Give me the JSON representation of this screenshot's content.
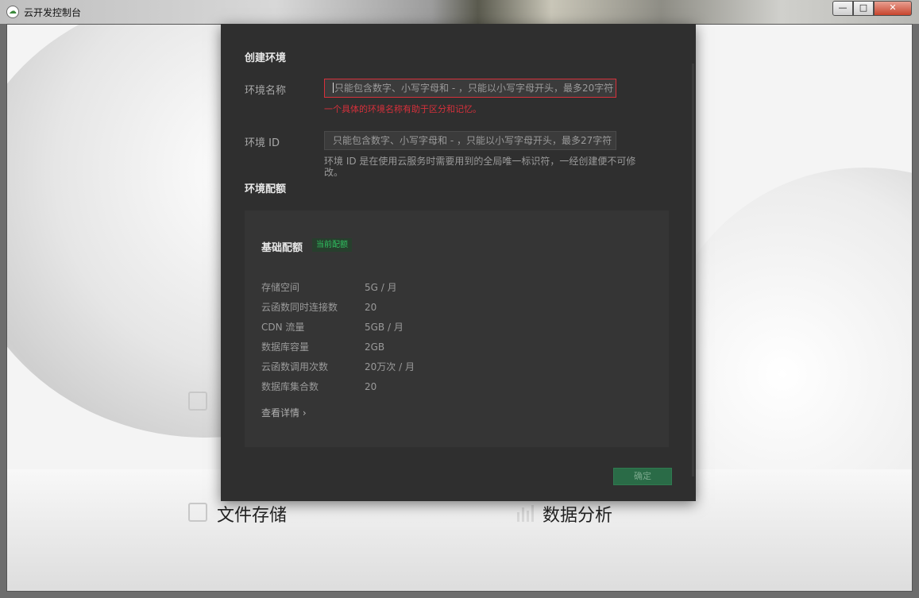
{
  "window": {
    "title": "云开发控制台",
    "app_icon": "cloud-logo-icon",
    "minimize_glyph": "—",
    "maximize_glyph": "□",
    "close_glyph": "✕"
  },
  "background": {
    "features": [
      {
        "title": "文件存储",
        "icon": "floppy-icon"
      },
      {
        "title": "数据分析",
        "icon": "bar-chart-icon"
      }
    ]
  },
  "modal": {
    "create_title": "创建环境",
    "env_name": {
      "label": "环境名称",
      "placeholder": "只能包含数字、小写字母和 - ，只能以小写字母开头，最多20字符",
      "error": "一个具体的环境名称有助于区分和记忆。"
    },
    "env_id": {
      "label": "环境 ID",
      "placeholder": "只能包含数字、小写字母和 - ，只能以小写字母开头，最多27字符",
      "hint": "环境 ID 是在使用云服务时需要用到的全局唯一标识符，一经创建便不可修改。"
    },
    "quota_title": "环境配额",
    "quota": {
      "title": "基础配额",
      "badge": "当前配额",
      "rows": [
        {
          "name": "存储空间",
          "value": "5G / 月"
        },
        {
          "name": "云函数同时连接数",
          "value": "20"
        },
        {
          "name": "CDN 流量",
          "value": "5GB / 月"
        },
        {
          "name": "数据库容量",
          "value": "2GB"
        },
        {
          "name": "云函数调用次数",
          "value": "20万次 / 月"
        },
        {
          "name": "数据库集合数",
          "value": "20"
        }
      ],
      "detail_link": "查看详情 ›"
    },
    "confirm_label": "确定"
  },
  "colors": {
    "modal_bg": "#2f2f2f",
    "error": "#d7303b",
    "accent_green": "#2fc160",
    "confirm_bg": "#2a6b47"
  }
}
